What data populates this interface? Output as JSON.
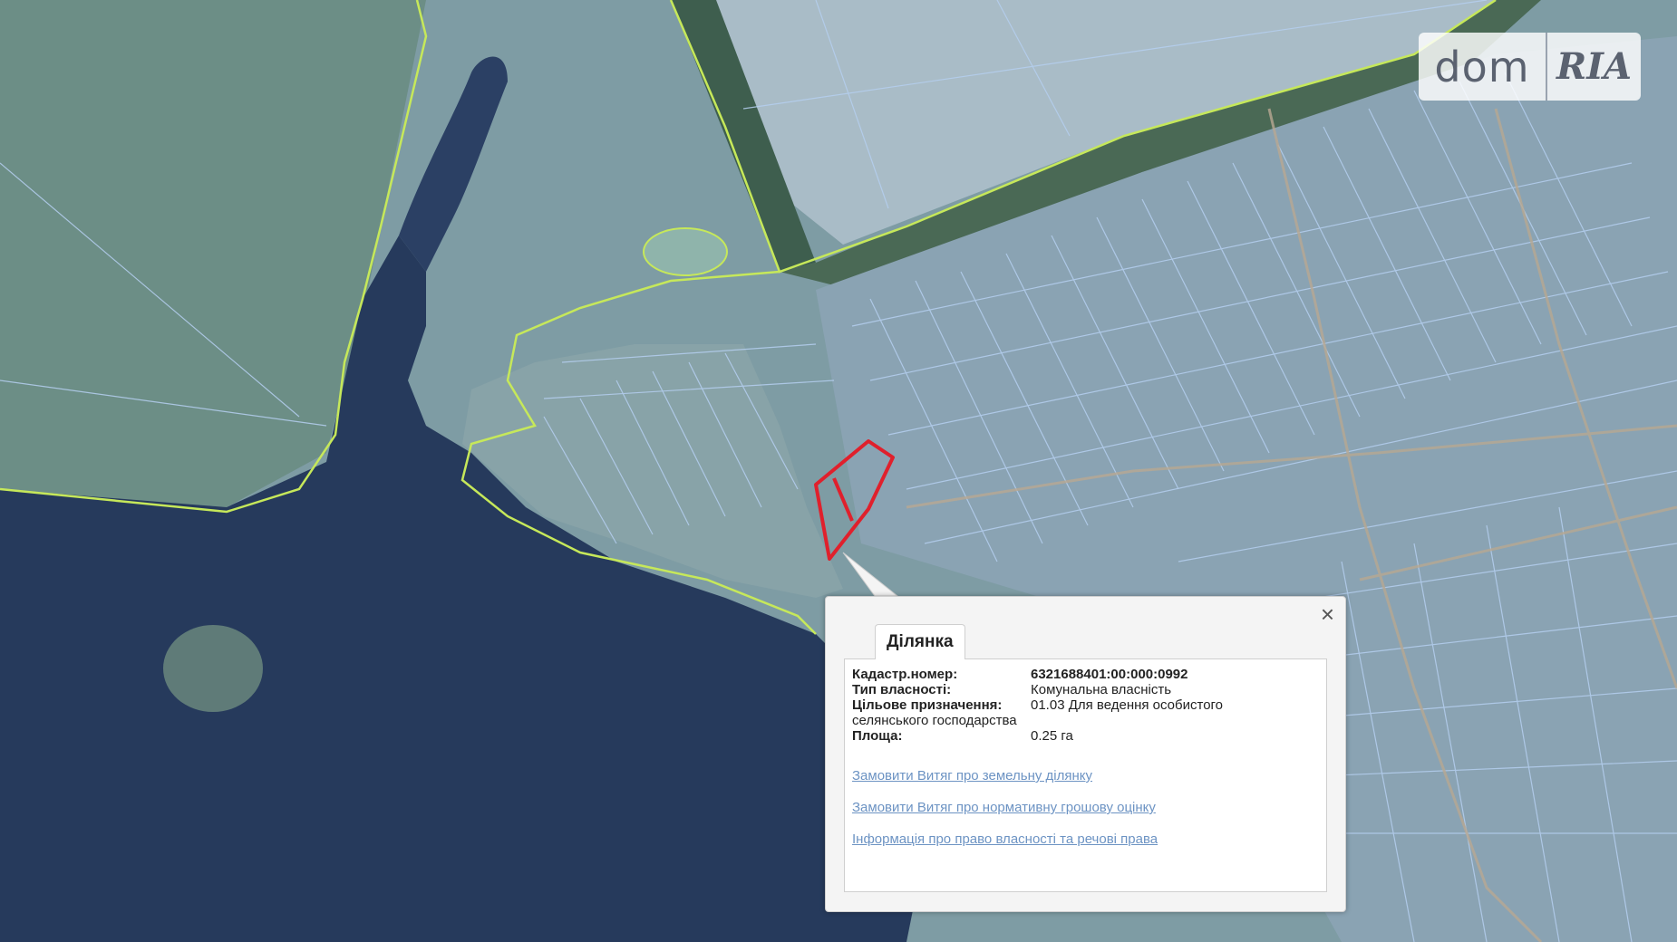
{
  "map": {
    "colors": {
      "water": "#263a5c",
      "land": "#7f9fa6",
      "boundary": "#c6e85a",
      "parcel_stroke": "#a9c6ee",
      "selected_parcel": "#e0202c"
    }
  },
  "watermark": {
    "dom": "dom",
    "ria": "RIA"
  },
  "popup": {
    "tab_label": "Ділянка",
    "close_icon": "close-icon",
    "rows": [
      {
        "label": "Кадастр.номер:",
        "value": "6321688401:00:000:0992"
      },
      {
        "label": "Тип власності:",
        "value": "Комунальна власність"
      },
      {
        "label": "Цільове призначення:",
        "value": "01.03 Для ведення особистого"
      },
      {
        "label": "",
        "value": "селянського господарства"
      },
      {
        "label": "Площа:",
        "value": "0.25 га"
      }
    ],
    "row4_label_full": "селянського господарства",
    "links": [
      "Замовити Витяг про земельну ділянку",
      "Замовити Витяг про нормативну грошову оцінку",
      "Інформація про право власності та речові права"
    ]
  }
}
